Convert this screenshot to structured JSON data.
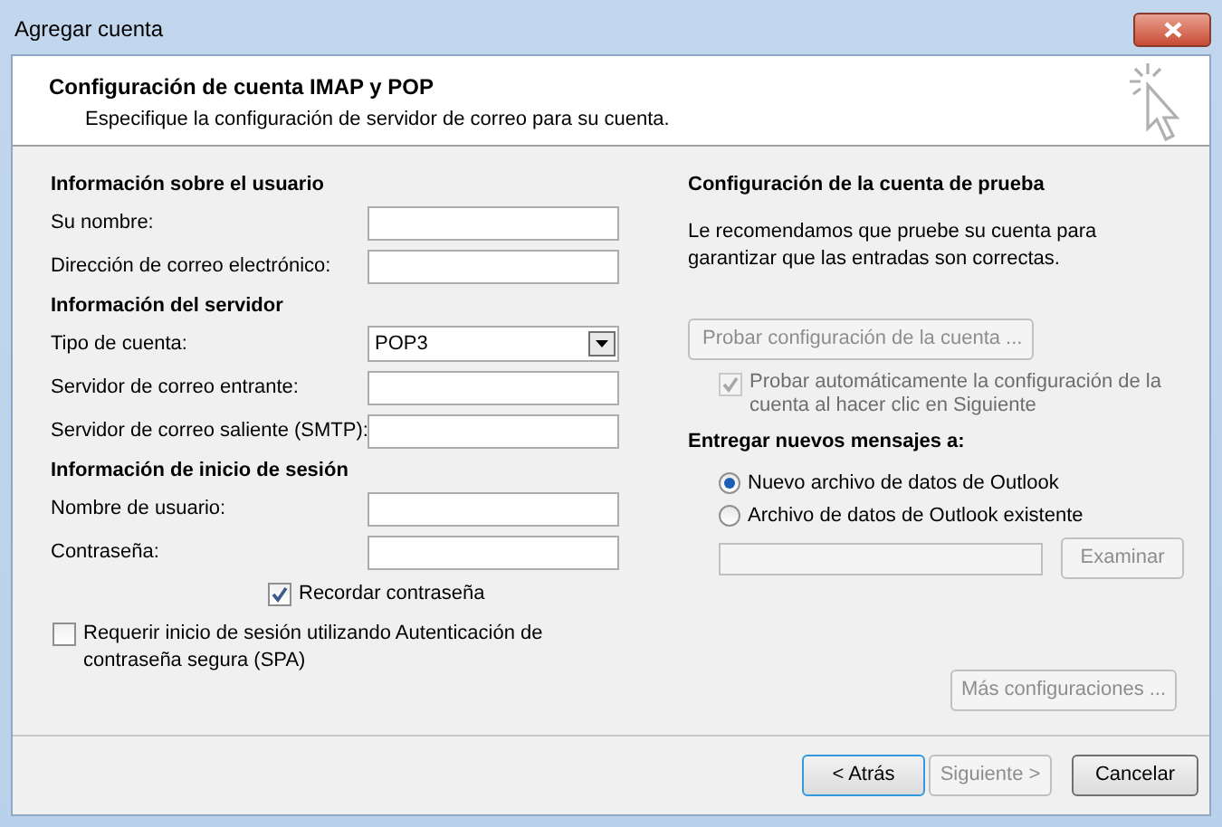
{
  "window": {
    "title": "Agregar cuenta"
  },
  "header": {
    "title": "Configuración de cuenta IMAP y POP",
    "subtitle": "Especifique la configuración de servidor de correo para su cuenta."
  },
  "left_sections": [
    {
      "heading": "Información sobre el usuario",
      "fields": [
        {
          "kind": "text",
          "label": "Su nombre:"
        },
        {
          "kind": "text",
          "label": "Dirección de correo electrónico:"
        }
      ]
    },
    {
      "heading": "Información del servidor",
      "fields": [
        {
          "kind": "select",
          "label": "Tipo de cuenta:",
          "value": "POP3"
        },
        {
          "kind": "text",
          "label": "Servidor de correo entrante:"
        },
        {
          "kind": "text",
          "label": "Servidor de correo saliente (SMTP):"
        }
      ]
    },
    {
      "heading": "Información de inicio de sesión",
      "fields": [
        {
          "kind": "text",
          "label": "Nombre de usuario:"
        },
        {
          "kind": "text",
          "label": "Contraseña:"
        }
      ]
    }
  ],
  "remember_password": {
    "label": "Recordar contraseña",
    "checked": true
  },
  "spa": {
    "label": "Requerir inicio de sesión utilizando Autenticación de contraseña segura (SPA)",
    "checked": false
  },
  "test": {
    "heading": "Configuración de la cuenta de prueba",
    "description": "Le recomendamos que pruebe su cuenta para garantizar que las entradas son correctas.",
    "button": {
      "label": "Probar configuración de la cuenta ...",
      "disabled": true
    },
    "auto_test": {
      "label": "Probar automáticamente la configuración de la cuenta al hacer clic en Siguiente",
      "checked": true,
      "disabled": true
    }
  },
  "deliver": {
    "heading": "Entregar nuevos mensajes a:",
    "options": [
      {
        "label": "Nuevo archivo de datos de Outlook",
        "selected": true
      },
      {
        "label": "Archivo de datos de Outlook existente",
        "selected": false
      }
    ],
    "browse": {
      "label": "Examinar",
      "disabled": true
    }
  },
  "more_settings": {
    "label": "Más configuraciones ...",
    "disabled": true
  },
  "footer_buttons": [
    {
      "label": "< Atrás",
      "disabled": false,
      "default": true
    },
    {
      "label": "Siguiente >",
      "disabled": true,
      "default": false
    },
    {
      "label": "Cancelar",
      "disabled": false,
      "default": false
    }
  ]
}
